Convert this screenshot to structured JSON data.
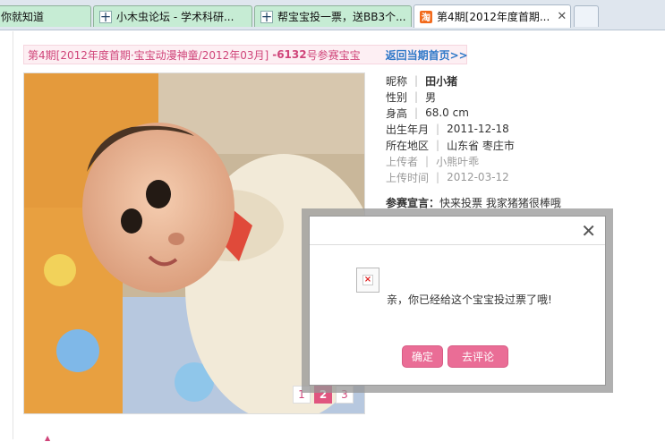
{
  "browser": {
    "tabs": [
      {
        "label": "你就知道",
        "icon": "none",
        "active": false
      },
      {
        "label": "小木虫论坛 - 学术科研...",
        "icon": "forum-icon",
        "active": false
      },
      {
        "label": "帮宝宝投一票，送BB3个...",
        "icon": "forum-icon",
        "active": false
      },
      {
        "label": "第4期[2012年度首期...",
        "icon": "taobao-icon",
        "active": true
      }
    ],
    "close_glyph": "✕"
  },
  "page": {
    "title_period": "第4期[2012年度首期·宝宝动漫神童/2012年03月]",
    "title_number": "-6132",
    "title_suffix": "号参赛宝宝",
    "back_link": "返回当期首页>>"
  },
  "profile": {
    "rows": [
      {
        "key": "昵称",
        "value": "田小猪"
      },
      {
        "key": "性别",
        "value": "男"
      },
      {
        "key": "身高",
        "value": "68.0 cm"
      },
      {
        "key": "出生年月",
        "value": "2011-12-18"
      },
      {
        "key": "所在地区",
        "value": "山东省 枣庄市"
      },
      {
        "key": "上传者",
        "value": "小熊叶乖"
      },
      {
        "key": "上传时间",
        "value": "2012-03-12"
      }
    ],
    "declaration_key": "参赛宣言：",
    "declaration_value": "快来投票 我家猪猪很棒哦"
  },
  "pager": {
    "pages": [
      "1",
      "2",
      "3"
    ],
    "current": "2"
  },
  "dialog": {
    "close_glyph": "✕",
    "message": "亲，你已经给这个宝宝投过票了哦!",
    "ok_label": "确定",
    "comment_label": "去评论"
  }
}
